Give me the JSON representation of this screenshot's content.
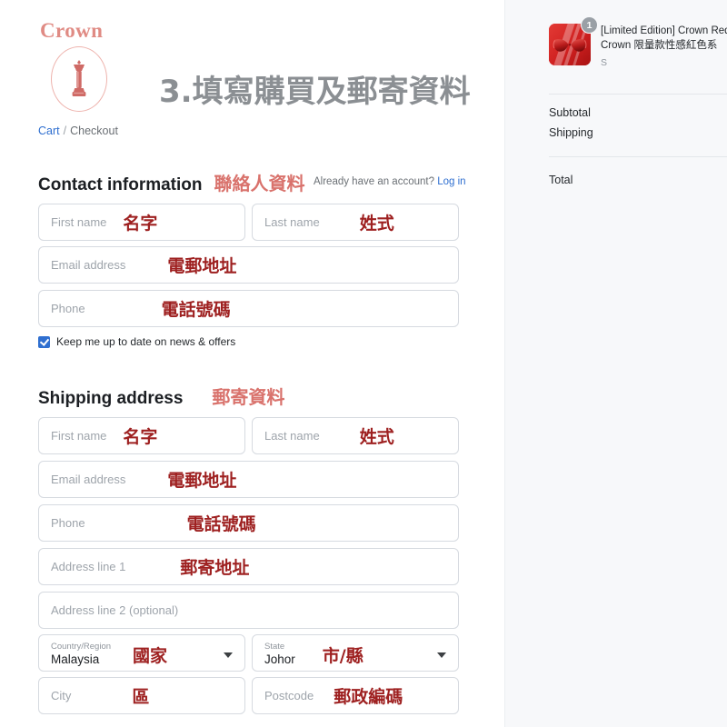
{
  "brand": {
    "word": "Crown",
    "mark_icon": "chess-queen-icon",
    "accent": "#e08b84"
  },
  "breadcrumb": {
    "cart_label": "Cart",
    "separator": "/",
    "current_label": "Checkout"
  },
  "page_title": "3.填寫購買及郵寄資料",
  "contact": {
    "heading_en": "Contact information",
    "heading_annotation": "聯絡人資料",
    "login_hint": "Already have an account?",
    "login_link": "Log in",
    "fields": [
      {
        "placeholder": "First name",
        "annotation": "名字"
      },
      {
        "placeholder": "Last name",
        "annotation": "姓式"
      },
      {
        "placeholder": "Email address",
        "annotation": "電郵地址"
      },
      {
        "placeholder": "Phone",
        "annotation": "電話號碼"
      }
    ],
    "newsletter_label": "Keep me up to date on news & offers",
    "newsletter_checked": "true"
  },
  "shipping": {
    "heading_en": "Shipping address",
    "heading_annotation": "郵寄資料",
    "fields": [
      {
        "placeholder": "First name",
        "annotation": "名字"
      },
      {
        "placeholder": "Last name",
        "annotation": "姓式"
      },
      {
        "placeholder": "Email address",
        "annotation": "電郵地址"
      },
      {
        "placeholder": "Phone",
        "annotation": "電話號碼"
      },
      {
        "placeholder": "Address line 1",
        "annotation": "郵寄地址"
      },
      {
        "placeholder": "Address line 2 (optional)",
        "annotation": ""
      },
      {
        "placeholder": "City",
        "annotation": "區"
      },
      {
        "placeholder": "Postcode",
        "annotation": "郵政編碼"
      }
    ],
    "country": {
      "label": "Country/Region",
      "value": "Malaysia",
      "annotation": "國家"
    },
    "state": {
      "label": "State",
      "value": "Johor",
      "annotation": "市/縣"
    }
  },
  "summary": {
    "item": {
      "title": "[Limited Edition] Crown Red Crown 限量款性感紅色系",
      "variant": "S",
      "quantity": "1",
      "thumb_icon": "red-lingerie-product-thumbnail"
    },
    "subtotal_label": "Subtotal",
    "subtotal_value": "",
    "shipping_label": "Shipping",
    "shipping_value": "",
    "total_label": "Total",
    "total_value": ""
  },
  "colors": {
    "annotation_dark_red": "#9e2020",
    "annotation_light_red": "#d9726c",
    "link_blue": "#2f6fd0",
    "title_gray": "#8b8f93",
    "sidebar_bg": "#f7f8fa",
    "field_border": "#d6dae0"
  }
}
